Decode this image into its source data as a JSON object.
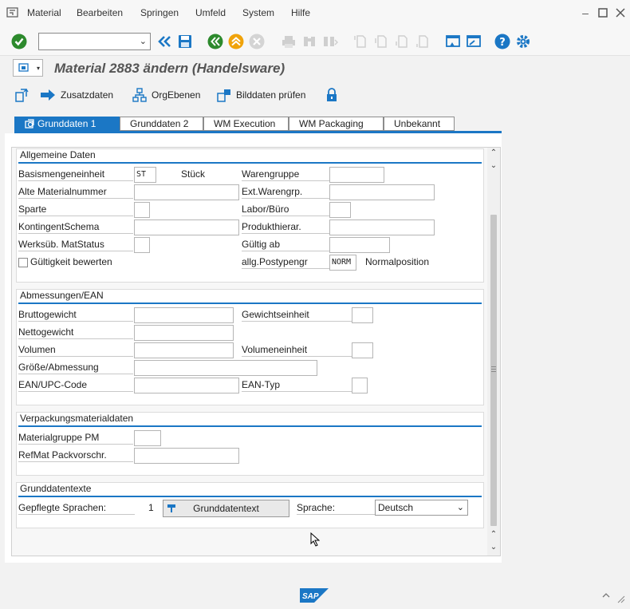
{
  "menu": [
    "Material",
    "Bearbeiten",
    "Springen",
    "Umfeld",
    "System",
    "Hilfe"
  ],
  "toolbar": {
    "command_value": ""
  },
  "title": "Material 2883 ändern (Handelsware)",
  "app_toolbar": {
    "zusatzdaten": "Zusatzdaten",
    "orgebenen": "OrgEbenen",
    "bilddaten": "Bilddaten prüfen"
  },
  "tabs": [
    "Grunddaten 1",
    "Grunddaten 2",
    "WM Execution",
    "WM Packaging",
    "Unbekannt"
  ],
  "allgemeine": {
    "title": "Allgemeine Daten",
    "basismenge_label": "Basismengeneinheit",
    "basismenge_value": "ST",
    "basismenge_text": "Stück",
    "warengruppe_label": "Warengruppe",
    "alte_mat_label": "Alte Materialnummer",
    "ext_waren_label": "Ext.Warengrp.",
    "sparte_label": "Sparte",
    "labor_label": "Labor/Büro",
    "kontingent_label": "KontingentSchema",
    "produkthier_label": "Produkthierar.",
    "werksueb_label": "Werksüb. MatStatus",
    "gueltig_label": "Gültig ab",
    "gueltigkeit_label": "Gültigkeit bewerten",
    "postyp_label": "allg.Postypengr",
    "postyp_value": "NORM",
    "postyp_text": "Normalposition"
  },
  "abmessungen": {
    "title": "Abmessungen/EAN",
    "brutto_label": "Bruttogewicht",
    "gewichtseinheit_label": "Gewichtseinheit",
    "netto_label": "Nettogewicht",
    "volumen_label": "Volumen",
    "volumeneinheit_label": "Volumeneinheit",
    "groesse_label": "Größe/Abmessung",
    "ean_label": "EAN/UPC-Code",
    "eantyp_label": "EAN-Typ"
  },
  "verpackung": {
    "title": "Verpackungsmaterialdaten",
    "matgruppe_label": "Materialgruppe PM",
    "refmat_label": "RefMat Packvorschr."
  },
  "grunddatentexte": {
    "title": "Grunddatentexte",
    "sprachen_label": "Gepflegte Sprachen:",
    "sprachen_count": "1",
    "button_label": "Grunddatentext",
    "sprache_label": "Sprache:",
    "sprache_value": "Deutsch"
  },
  "colors": {
    "accent": "#1b77c5",
    "ok_green": "#2d8a2d",
    "orange": "#f0a30a"
  }
}
